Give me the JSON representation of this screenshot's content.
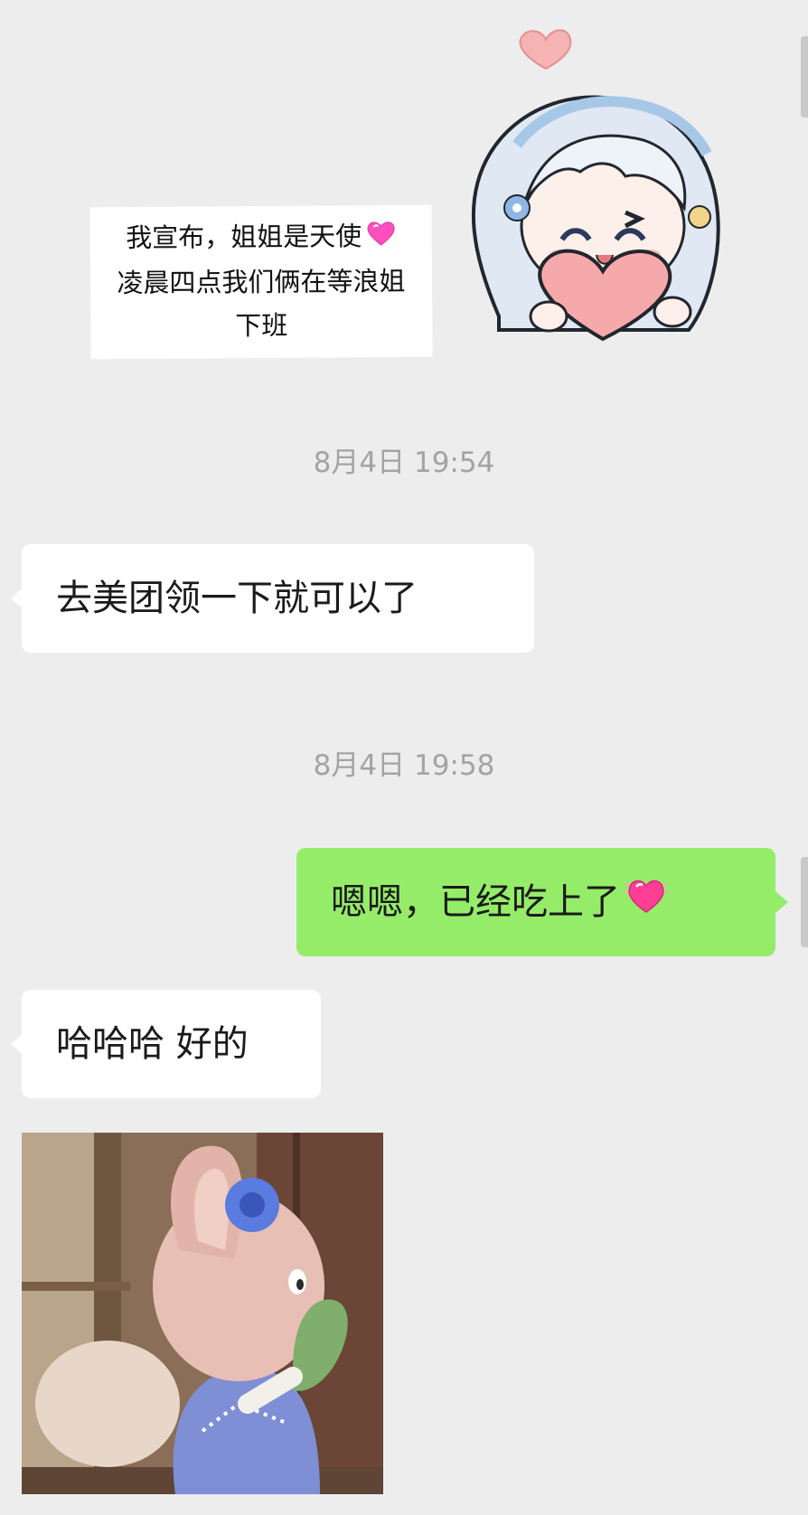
{
  "sticker_top": {
    "caption_lines": [
      "我宣布，姐姐是天使",
      "凌晨四点我们俩在等浪姐",
      "下班"
    ],
    "icon": "sparkling-heart-icon"
  },
  "messages": [
    {
      "type": "timestamp",
      "text": "8月4日 19:54"
    },
    {
      "type": "text",
      "side": "left",
      "text": "去美团领一下就可以了"
    },
    {
      "type": "timestamp",
      "text": "8月4日 19:58"
    },
    {
      "type": "text",
      "side": "right",
      "text": "嗯嗯，已经吃上了",
      "emoji": "beating-heart-icon"
    },
    {
      "type": "text",
      "side": "left",
      "text": "哈哈哈 好的"
    },
    {
      "type": "image",
      "side": "left",
      "sticker": "plush-bunny-waving"
    }
  ],
  "colors": {
    "background": "#ededed",
    "incoming_bubble": "#ffffff",
    "outgoing_bubble": "#95ec69",
    "timestamp_text": "#a3a3a3"
  }
}
